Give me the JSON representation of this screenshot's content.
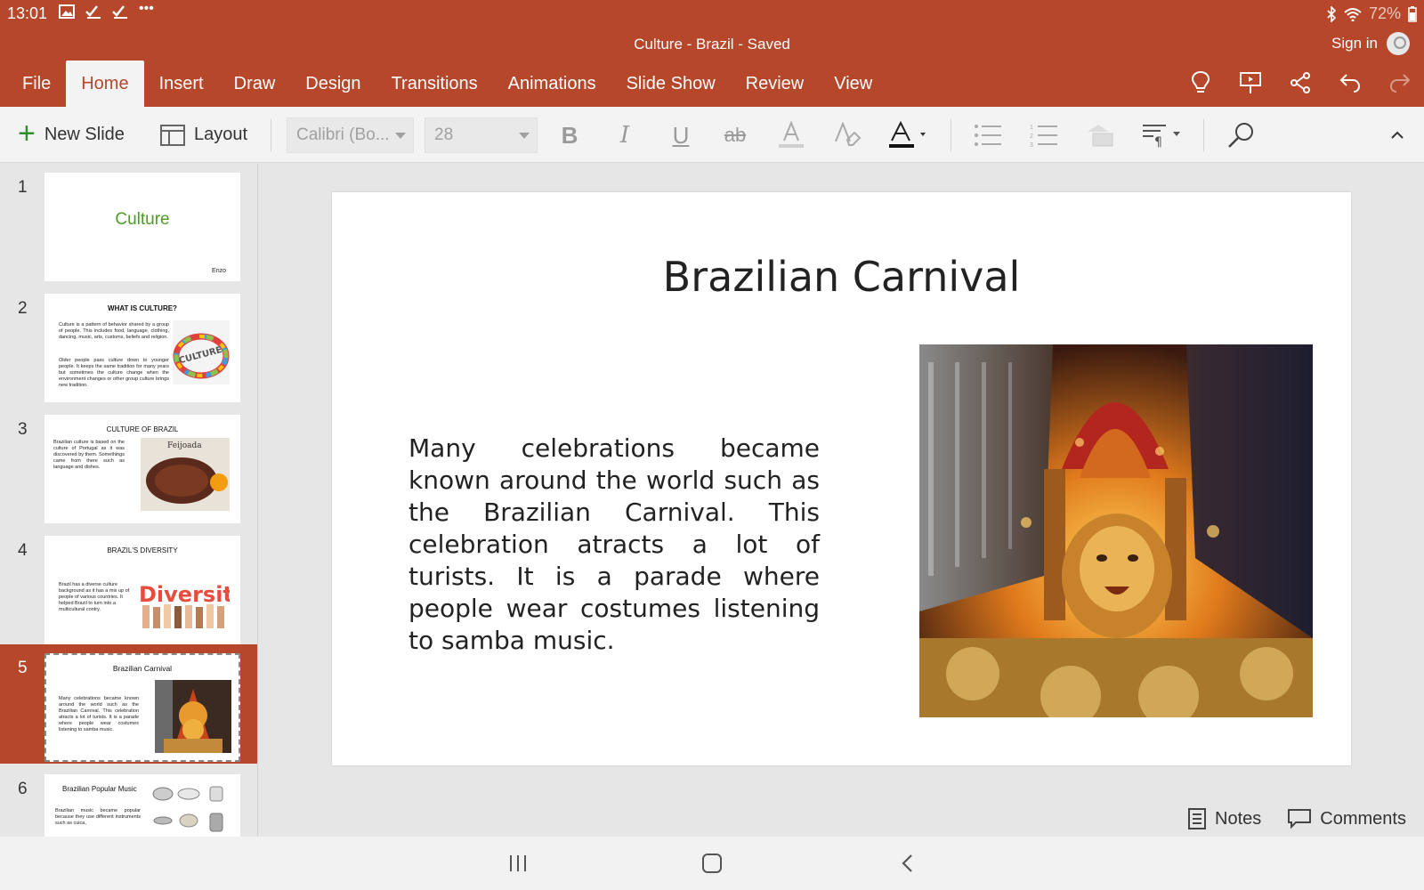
{
  "status": {
    "time": "13:01",
    "battery": "72%"
  },
  "window": {
    "title": "Culture - Brazil - Saved",
    "sign_in": "Sign in"
  },
  "tabs": [
    "File",
    "Home",
    "Insert",
    "Draw",
    "Design",
    "Transitions",
    "Animations",
    "Slide Show",
    "Review",
    "View"
  ],
  "active_tab": "Home",
  "ribbon": {
    "new_slide": "New Slide",
    "layout": "Layout",
    "font_name": "Calibri (Bo...",
    "font_size": "28",
    "bold": "B",
    "italic": "I",
    "underline": "U",
    "strike": "ab"
  },
  "thumbnails": [
    {
      "num": "1",
      "title": "Culture",
      "author": "Enzo"
    },
    {
      "num": "2",
      "title": "WHAT IS CULTURE?",
      "text1": "Culture is a pattern of behavior shared by a group of people. This includes food, language, clothing, dancing, music, arts, customs, beliefs and religion.",
      "text2": "Older people pass culture down to younger people. It keeps the same tradition for many years but sometimes the culture change when the environment changes or other group culture brings new tradition.",
      "image_text": "CULTURE"
    },
    {
      "num": "3",
      "title": "CULTURE OF BRAZIL",
      "text1": "Brazilian culture is based on the culture of Portugal as it was discovered by them. Somethings came from there such as language and dishes.",
      "image_text": "Feijoada"
    },
    {
      "num": "4",
      "title": "BRAZIL'S DIVERSITY",
      "text1": "Brazil has a diverse culture background as it has a mix up of people of various countries. It helped Brazil to turn into a multicultural contry.",
      "image_text": "Diversity"
    },
    {
      "num": "5",
      "title": "Brazilian Carnival",
      "text1": "Many celebrations became known around the world such as the Brazilian Carnival. This celebration atracts a lot of turists. It is a parade where people wear costumes listening to samba music."
    },
    {
      "num": "6",
      "title": "Brazilian Popular Music",
      "text1": "Brazilian music became popular because they use different instruments such as cuica,"
    }
  ],
  "slide": {
    "title": "Brazilian Carnival",
    "body": "Many celebrations became known around the world such as the Brazilian Carnival. This celebration atracts a lot of turists. It is a parade where people wear costumes listening to samba music."
  },
  "bottom": {
    "notes": "Notes",
    "comments": "Comments"
  },
  "colors": {
    "accent": "#b7472a",
    "ribbon_bg": "#f3f3f3"
  }
}
